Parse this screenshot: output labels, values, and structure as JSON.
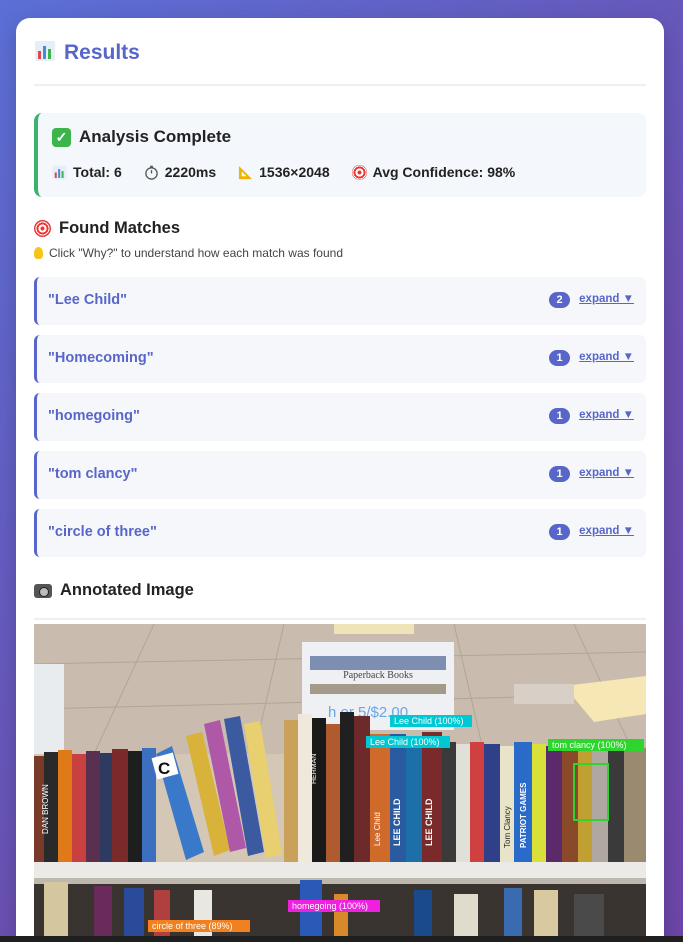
{
  "header": {
    "icon": "bar-chart-icon",
    "title": "Results"
  },
  "summary": {
    "title": "Analysis Complete",
    "total_label": "Total: 6",
    "time_label": "2220ms",
    "size_label": "1536×2048",
    "confidence_label": "Avg Confidence: 98%"
  },
  "matches_section": {
    "title": "Found Matches",
    "hint": "Click \"Why?\" to understand how each match was found",
    "expand_label": "expand ▼",
    "items": [
      {
        "name": "\"Lee Child\"",
        "count": "2"
      },
      {
        "name": "\"Homecoming\"",
        "count": "1"
      },
      {
        "name": "\"homegoing\"",
        "count": "1"
      },
      {
        "name": "\"tom clancy\"",
        "count": "1"
      },
      {
        "name": "\"circle of three\"",
        "count": "1"
      }
    ]
  },
  "image_section": {
    "title": "Annotated Image",
    "sign_text": "Paperback Books",
    "price_text": "h or 5/$2.00",
    "labels": [
      "Lee Child (100%)",
      "Lee Child (100%)",
      "tom clancy (100%)",
      "homegoing (100%)",
      "circle of three (89%)"
    ],
    "spine_texts": [
      "DAN BROWN",
      "LEE CHILD",
      "LEE CHILD",
      "Lee Child",
      "PATRIOT GAMES",
      "Tom Clancy",
      "HERMAN",
      "C"
    ]
  },
  "colors": {
    "accent": "#5866c9",
    "success": "#39b36b",
    "box_cyan": "#00c8d2",
    "box_green": "#2ed52e",
    "box_magenta": "#f020e0",
    "box_orange": "#f08020"
  }
}
